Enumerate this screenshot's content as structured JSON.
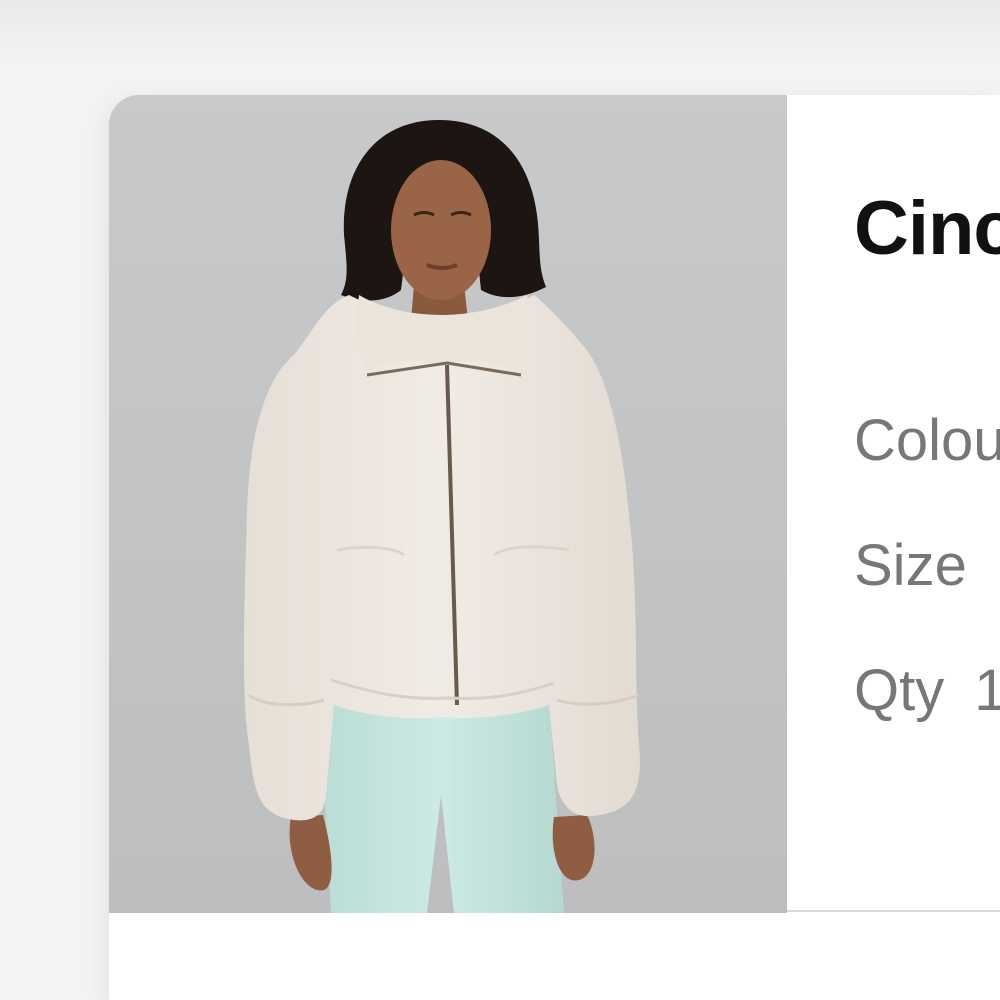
{
  "product": {
    "title": "Cinc",
    "attributes": [
      {
        "label": "Colou",
        "value": ""
      },
      {
        "label": "Size",
        "value": ""
      },
      {
        "label": "Qty",
        "value": "1"
      }
    ]
  }
}
